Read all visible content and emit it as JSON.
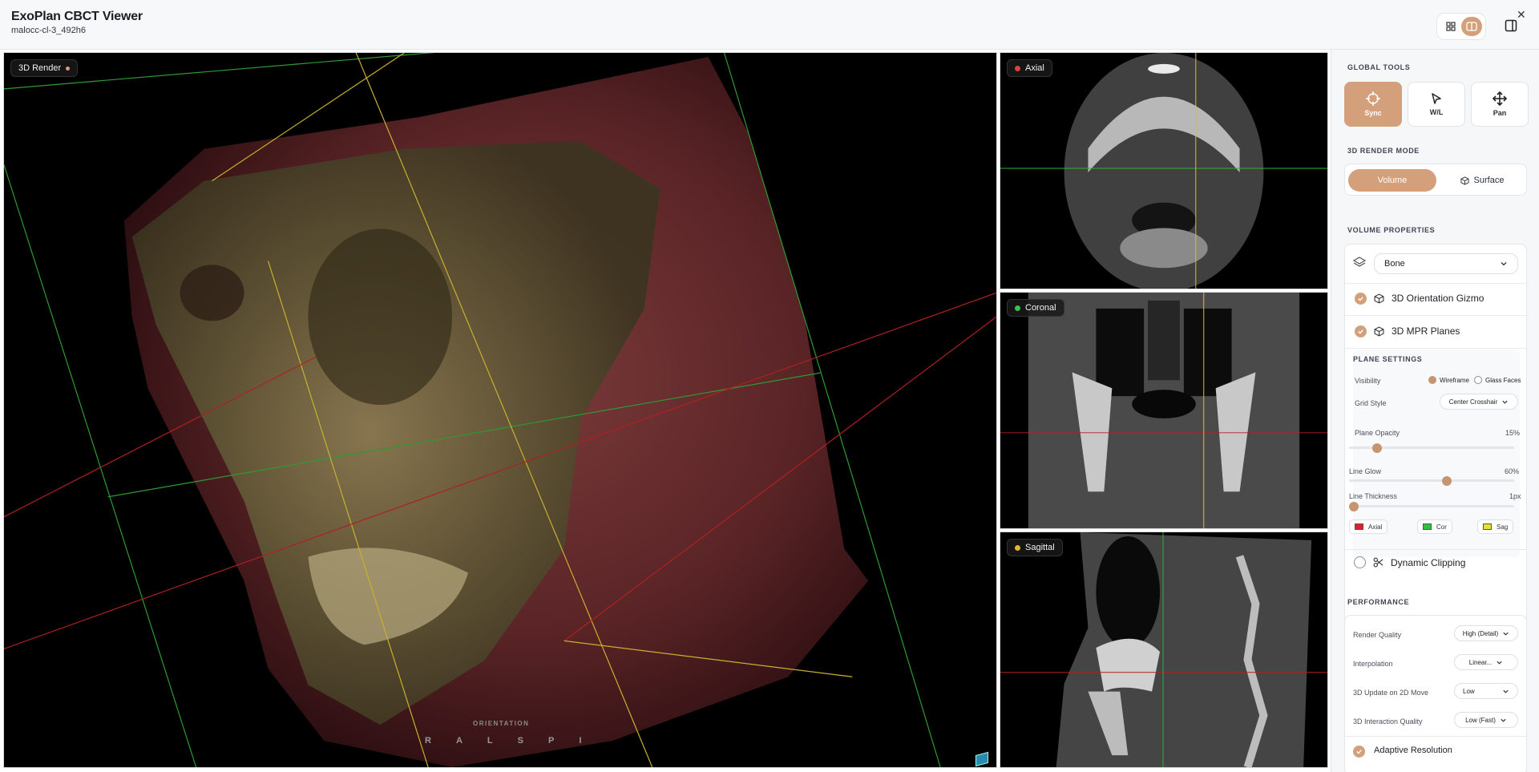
{
  "header": {
    "title": "ExoPlan CBCT Viewer",
    "subtitle": "malocc-cl-3_492h6"
  },
  "viewports": {
    "render3d": {
      "label": "3D Render",
      "orientation_title": "ORIENTATION",
      "orientation_letters": [
        "R",
        "A",
        "L",
        "S",
        "P",
        "I"
      ]
    },
    "axial": {
      "label": "Axial",
      "color": "#e04040"
    },
    "coronal": {
      "label": "Coronal",
      "color": "#3cc04a"
    },
    "sagittal": {
      "label": "Sagittal",
      "color": "#e0b430"
    }
  },
  "sidebar": {
    "global_tools": {
      "title": "GLOBAL TOOLS",
      "tools": [
        {
          "label": "Sync",
          "icon": "crosshair-icon",
          "active": true
        },
        {
          "label": "W/L",
          "icon": "cursor-icon",
          "active": false
        },
        {
          "label": "Pan",
          "icon": "move-icon",
          "active": false
        }
      ]
    },
    "render_mode": {
      "title": "3D RENDER MODE",
      "volume": "Volume",
      "surface": "Surface"
    },
    "volume_properties": {
      "title": "VOLUME PROPERTIES",
      "preset": "Bone",
      "gizmo": "3D Orientation Gizmo",
      "mpr": "3D MPR Planes"
    },
    "plane_settings": {
      "title": "PLANE SETTINGS",
      "visibility_label": "Visibility",
      "wireframe": "Wireframe",
      "glass": "Glass Faces",
      "grid_label": "Grid Style",
      "grid_value": "Center Crosshair",
      "opacity_label": "Plane Opacity",
      "opacity_value": "15%",
      "opacity_level": 0.15,
      "glow_label": "Line Glow",
      "glow_value": "60%",
      "glow_level": 0.6,
      "thickness_label": "Line Thickness",
      "thickness_value": "1px",
      "thickness_level": 0.0,
      "swatches": [
        {
          "label": "Axial",
          "color": "#e02020"
        },
        {
          "label": "Cor",
          "color": "#30c040"
        },
        {
          "label": "Sag",
          "color": "#e8e030"
        }
      ]
    },
    "clipping": {
      "label": "Dynamic Clipping"
    },
    "performance": {
      "title": "PERFORMANCE",
      "render_quality_label": "Render Quality",
      "render_quality_value": "High (Detail)",
      "interpolation_label": "Interpolation",
      "interpolation_value": "Linear...",
      "update_label": "3D Update on 2D Move",
      "update_value": "Low",
      "interaction_label": "3D Interaction Quality",
      "interaction_value": "Low (Fast)",
      "adaptive_label": "Adaptive Resolution"
    }
  },
  "colors": {
    "accent": "#d4a07c",
    "axial": "#e04040",
    "coronal": "#3cc04a",
    "sagittal": "#e0b430"
  }
}
